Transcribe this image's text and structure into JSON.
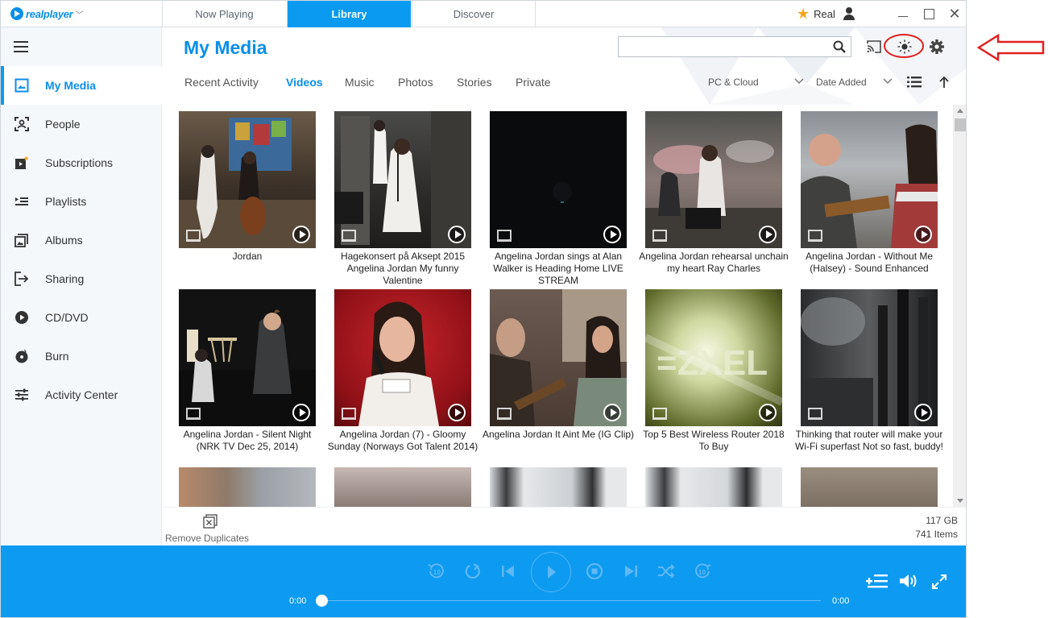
{
  "app": {
    "logo_text": "realplayer",
    "tabs": [
      {
        "label": "Now Playing",
        "active": false
      },
      {
        "label": "Library",
        "active": true
      },
      {
        "label": "Discover",
        "active": false
      }
    ],
    "account_label": "Real"
  },
  "sidebar": {
    "items": [
      {
        "label": "My Media",
        "icon": "my-media-icon",
        "active": true
      },
      {
        "label": "People",
        "icon": "people-icon"
      },
      {
        "label": "Subscriptions",
        "icon": "subscriptions-icon"
      },
      {
        "label": "Playlists",
        "icon": "playlists-icon"
      },
      {
        "label": "Albums",
        "icon": "albums-icon"
      },
      {
        "label": "Sharing",
        "icon": "sharing-icon"
      },
      {
        "label": "CD/DVD",
        "icon": "cd-dvd-icon"
      },
      {
        "label": "Burn",
        "icon": "burn-icon"
      },
      {
        "label": "Activity Center",
        "icon": "activity-center-icon"
      }
    ]
  },
  "header": {
    "title": "My Media",
    "search": {
      "value": "",
      "placeholder": ""
    },
    "subtabs": [
      "Recent Activity",
      "Videos",
      "Music",
      "Photos",
      "Stories",
      "Private"
    ],
    "active_subtab": "Videos",
    "source": "PC & Cloud",
    "sort": "Date Added"
  },
  "videos": [
    {
      "title": "Jordan"
    },
    {
      "title": "Hagekonsert på Aksept 2015 Angelina Jordan  My funny Valentine"
    },
    {
      "title": "Angelina Jordan sings at  Alan Walker is Heading Home LIVE STREAM"
    },
    {
      "title": "Angelina Jordan rehearsal unchain my heart Ray Charles"
    },
    {
      "title": "Angelina Jordan - Without Me (Halsey) - Sound Enhanced"
    },
    {
      "title": "Angelina Jordan - Silent Night (NRK TV Dec 25, 2014)"
    },
    {
      "title": "Angelina Jordan (7) - Gloomy Sunday (Norways Got Talent 2014)"
    },
    {
      "title": "Angelina Jordan  It Aint Me   (IG Clip)"
    },
    {
      "title": "Top 5 Best Wireless Router 2018 To Buy"
    },
    {
      "title": "Thinking that router will make your Wi-Fi superfast  Not so fast, buddy!"
    },
    {
      "title": ""
    },
    {
      "title": ""
    },
    {
      "title": ""
    },
    {
      "title": ""
    },
    {
      "title": ""
    }
  ],
  "status": {
    "remove_duplicates": "Remove Duplicates",
    "storage": "117 GB",
    "items": "741 Items"
  },
  "player": {
    "time_current": "0:00",
    "time_total": "0:00",
    "progress": 0
  },
  "colors": {
    "accent": "#0a9bf0",
    "title_blue": "#0a8fe8",
    "annotation_red": "#e02020"
  }
}
